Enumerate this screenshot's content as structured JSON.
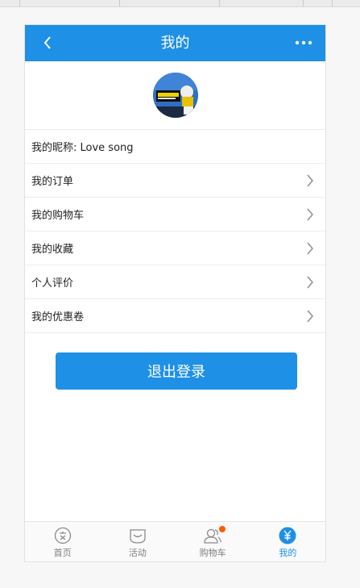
{
  "header": {
    "title": "我的",
    "back_icon": "chevron-left-icon",
    "more_icon": "more-horizontal-icon",
    "color": "#1e90e6"
  },
  "profile": {
    "avatar_icon": "avatar-image"
  },
  "list": {
    "nickname": "我的昵称: Love song",
    "items": [
      {
        "label": "我的订单"
      },
      {
        "label": "我的购物车"
      },
      {
        "label": "我的收藏"
      },
      {
        "label": "个人评价"
      },
      {
        "label": "我的优惠卷"
      }
    ]
  },
  "logout_label": "退出登录",
  "tabbar": {
    "tabs": [
      {
        "label": "首页",
        "icon": "home-icon"
      },
      {
        "label": "活动",
        "icon": "activity-icon"
      },
      {
        "label": "购物车",
        "icon": "cart-icon",
        "badge": true
      },
      {
        "label": "我的",
        "icon": "yen-icon",
        "active": true
      }
    ],
    "active_color": "#1e90e6",
    "badge_color": "#ff5a00"
  }
}
